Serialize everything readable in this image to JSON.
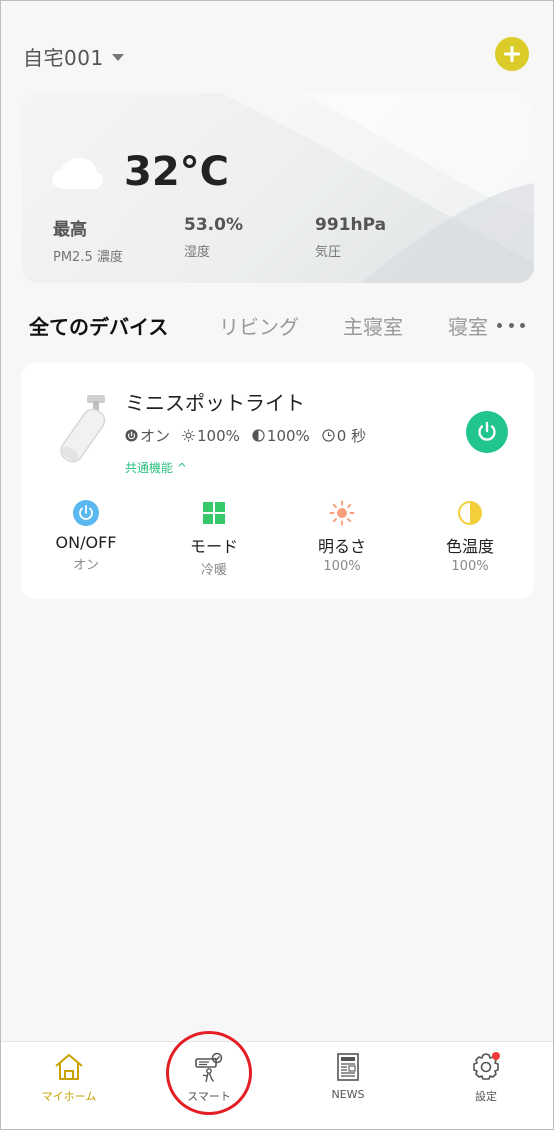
{
  "header": {
    "home_name": "自宅001"
  },
  "weather": {
    "temperature": "32°C",
    "stats": [
      {
        "value": "最高",
        "label": "PM2.5 濃度"
      },
      {
        "value": "53.0%",
        "label": "湿度"
      },
      {
        "value": "991hPa",
        "label": "気圧"
      }
    ]
  },
  "tabs": [
    "全てのデバイス",
    "リビング",
    "主寝室",
    "寝室"
  ],
  "device": {
    "name": "ミニスポットライト",
    "status": {
      "power": "オン",
      "brightness": "100%",
      "color_temp": "100%",
      "timer": "0 秒"
    },
    "common_functions": "共通機能 ^",
    "quick_controls": [
      {
        "label": "ON/OFF",
        "value": "オン",
        "icon": "power-icon"
      },
      {
        "label": "モード",
        "value": "冷暖",
        "icon": "grid-icon"
      },
      {
        "label": "明るさ",
        "value": "100%",
        "icon": "sun-icon"
      },
      {
        "label": "色温度",
        "value": "100%",
        "icon": "half-circle-icon"
      }
    ]
  },
  "nav": [
    {
      "label": "マイホーム",
      "icon": "home-icon",
      "active": true
    },
    {
      "label": "スマート",
      "icon": "smart-icon"
    },
    {
      "label": "NEWS",
      "icon": "news-icon"
    },
    {
      "label": "設定",
      "icon": "gear-icon"
    }
  ],
  "colors": {
    "accent": "#dccc2a",
    "power_green": "#22c58b",
    "highlight": "#e31e24",
    "link_green": "#2cbf7f"
  }
}
